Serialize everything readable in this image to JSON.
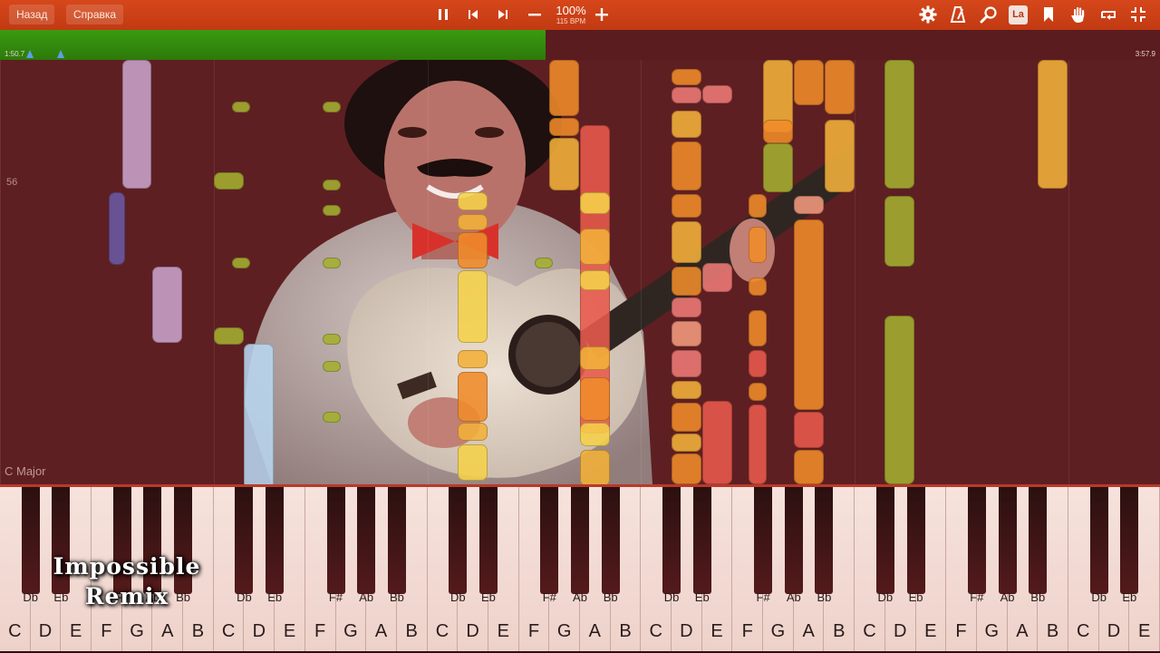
{
  "toolbar": {
    "back_label": "Назад",
    "help_label": "Справка",
    "tempo_percent": "100%",
    "tempo_bpm": "115 BPM",
    "la_label": "La",
    "icons": [
      "pause-icon",
      "skip-back-icon",
      "skip-forward-icon",
      "minus-icon",
      "plus-icon",
      "gear-icon",
      "metronome-icon",
      "zoom-icon",
      "bookmark-icon",
      "hand-icon",
      "loop-icon",
      "exit-fullscreen-icon"
    ]
  },
  "progress": {
    "elapsed": "1:50.7",
    "total": "3:57.9",
    "fraction": 0.47,
    "markers": [
      0.026,
      0.052
    ]
  },
  "roll": {
    "measure_number": "56",
    "key_signature": "C Major"
  },
  "keyboard": {
    "white_labels": [
      "C",
      "D",
      "E",
      "F",
      "G",
      "A",
      "B",
      "C",
      "D",
      "E",
      "F",
      "G",
      "A",
      "B",
      "C",
      "D",
      "E",
      "F",
      "G",
      "A",
      "B",
      "C",
      "D",
      "E",
      "F",
      "G",
      "A",
      "B",
      "C",
      "D",
      "E",
      "F",
      "G",
      "A",
      "B",
      "C",
      "D",
      "E"
    ],
    "black_labels": [
      "Db",
      "Eb",
      "F#",
      "Ab",
      "Bb",
      "Db",
      "Eb",
      "F#",
      "Ab",
      "Bb",
      "Db",
      "Eb",
      "F#",
      "Ab",
      "Bb",
      "Db",
      "Eb",
      "F#",
      "Ab",
      "Bb",
      "Db",
      "Eb",
      "F#",
      "Ab",
      "Bb",
      "Db",
      "Eb"
    ]
  },
  "watermark": {
    "line1": "Impossible",
    "line2": "Remix"
  },
  "colors": {
    "toolbar": "#c93f15",
    "progress_fill": "#34900d",
    "lavender": "#c9a3cc",
    "indigo": "#6a5aa4",
    "olive": "#a4b030",
    "orange": "#f08c2a",
    "gold": "#f3b13a",
    "yellow": "#f6d24a",
    "red": "#e95a4d",
    "pink": "#ee7b77",
    "salmon": "#f39a7e",
    "light_blue": "#b9d7f0"
  }
}
